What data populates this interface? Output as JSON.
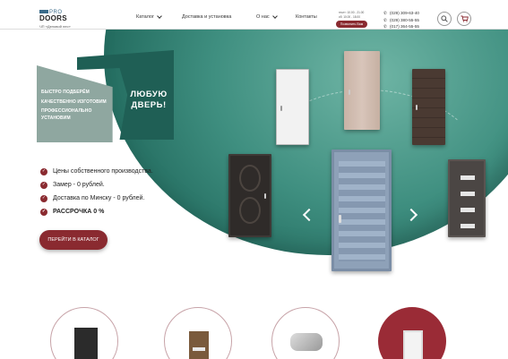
{
  "header": {
    "logo": {
      "pro": "PRO",
      "doors": "DOORS",
      "subtitle": "ЧП «Деловой лес»"
    },
    "nav": [
      {
        "label": "Каталог",
        "dropdown": true
      },
      {
        "label": "Доставка и установка",
        "dropdown": false
      },
      {
        "label": "О нас",
        "dropdown": true
      },
      {
        "label": "Контакты",
        "dropdown": false
      }
    ],
    "hours": [
      "пн-пт: 10.00 - 21.00",
      "сб: 10.00 - 18.00"
    ],
    "callback_label": "Позвонить Вам",
    "phones": [
      "(029) 309-63-40",
      "(029) 380-55-55",
      "(017) 364-55-55"
    ]
  },
  "hero": {
    "banner_lines": [
      "БЫСТРО ПОДБЕРЁМ",
      "КАЧЕСТВЕННО ИЗГОТОВИМ",
      "ПРОФЕССИОНАЛЬНО УСТАНОВИМ"
    ],
    "slogan": "ЛЮБУЮ ДВЕРЬ!",
    "bullets": [
      "Цены собственного производства.",
      "Замер  - 0 рублей.",
      "Доставка по Минску - 0 рублей.",
      "РАССРОЧКА 0 %"
    ],
    "cta_label": "ПЕРЕЙТИ В КАТАЛОГ"
  },
  "colors": {
    "accent": "#8a2a30",
    "teal": "#1f5f55"
  },
  "icons": {
    "search": "search-icon",
    "cart": "cart-icon",
    "phone": "phone-icon",
    "clock": "clock-icon"
  }
}
